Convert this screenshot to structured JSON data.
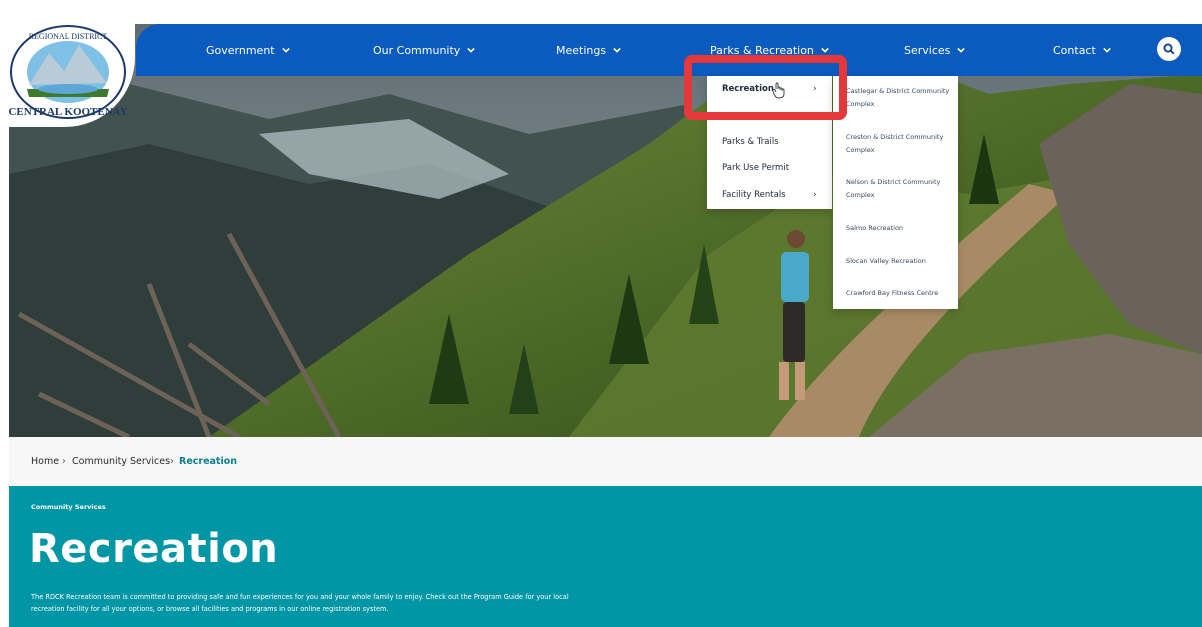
{
  "colors": {
    "nav": "#0a5ac0",
    "teal": "#0096a5",
    "highlight": "#e5383b"
  },
  "logo": {
    "top_text": "REGIONAL DISTRICT",
    "bottom_text": "CENTRAL KOOTENAY"
  },
  "nav": {
    "items": [
      "Government",
      "Our Community",
      "Meetings",
      "Parks & Recreation",
      "Services",
      "Contact"
    ],
    "search_icon": "search-icon"
  },
  "menu": {
    "items": [
      {
        "label": "Recreation",
        "has_submenu": true,
        "active": true
      },
      {
        "label": "Parks & Trails",
        "has_submenu": false
      },
      {
        "label": "Park Use Permit",
        "has_submenu": false
      },
      {
        "label": "Facility Rentals",
        "has_submenu": true
      }
    ],
    "submenu": [
      "Castlegar & District Community Complex",
      "Creston & District Community Complex",
      "Nelson & District Community Complex",
      "Salmo Recreation",
      "Slocan Valley Recreation",
      "Crawford Bay Fitness Centre"
    ]
  },
  "breadcrumb": {
    "home": "Home",
    "section": "Community Services",
    "current": "Recreation",
    "separator": "›"
  },
  "page": {
    "eyebrow": "Community Services",
    "title": "Recreation",
    "description": "The RDCK Recreation team is committed to providing safe and fun experiences for you and your whole family to enjoy. Check out the Program Guide for your local recreation facility for all your options, or browse all facilities and programs in our online registration system."
  }
}
